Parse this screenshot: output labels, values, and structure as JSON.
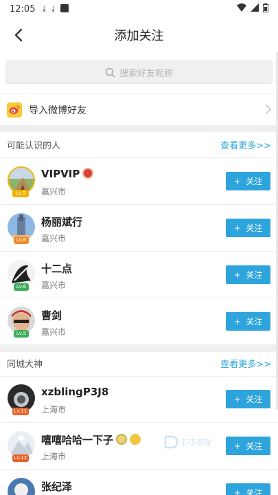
{
  "status_bar": {
    "time": "12:05"
  },
  "header": {
    "title": "添加关注"
  },
  "search": {
    "placeholder": "搜索好友昵称"
  },
  "import_weibo": {
    "label": "导入微博好友"
  },
  "sections": [
    {
      "title": "可能认识的人",
      "more": "查看更多>>",
      "users": [
        {
          "name": "VIPVIP",
          "city": "嘉兴市",
          "level": "Lv.0",
          "follow_label": "关注"
        },
        {
          "name": "杨丽斌行",
          "city": "嘉兴市",
          "level": "Lv.6",
          "follow_label": "关注"
        },
        {
          "name": "十二点",
          "city": "嘉兴市",
          "level": "Lv.6",
          "follow_label": "关注"
        },
        {
          "name": "曹剑",
          "city": "嘉兴市",
          "level": "Lv.5",
          "follow_label": "关注"
        }
      ]
    },
    {
      "title": "同城大神",
      "more": "查看更多>>",
      "users": [
        {
          "name": "xzblingP3J8",
          "city": "上海市",
          "level": "Lv.11",
          "follow_label": "关注"
        },
        {
          "name": "嘻嘻哈哈一下子",
          "city": "上海市",
          "level": "Lv.12",
          "follow_label": "关注"
        },
        {
          "name": "张纪泽",
          "city": "",
          "level": "",
          "follow_label": "关注"
        }
      ]
    }
  ],
  "watermark": {
    "text": "175游戏"
  },
  "colors": {
    "accent": "#2ea4dc",
    "level_green": "#3fae5a",
    "level_orange": "#f08c2e"
  }
}
